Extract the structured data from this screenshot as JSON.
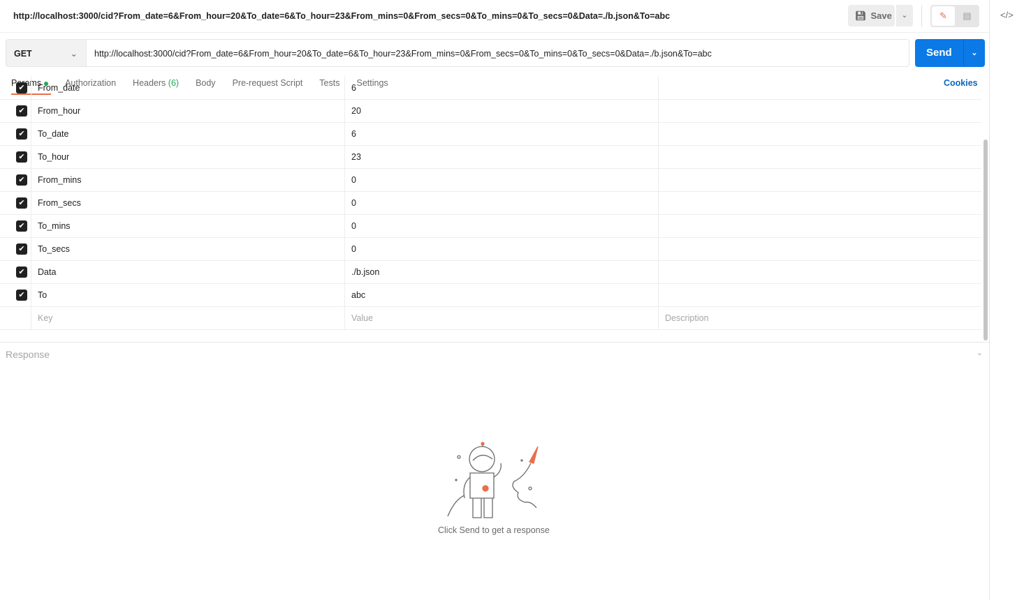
{
  "header": {
    "title": "http://localhost:3000/cid?From_date=6&From_hour=20&To_date=6&To_hour=23&From_mins=0&From_secs=0&To_mins=0&To_secs=0&Data=./b.json&To=abc",
    "save_label": "Save"
  },
  "request": {
    "method": "GET",
    "url": "http://localhost:3000/cid?From_date=6&From_hour=20&To_date=6&To_hour=23&From_mins=0&From_secs=0&To_mins=0&To_secs=0&Data=./b.json&To=abc",
    "send_label": "Send"
  },
  "tabs": [
    {
      "label": "Params"
    },
    {
      "label": "Authorization"
    },
    {
      "label": "Headers",
      "count": "(6)"
    },
    {
      "label": "Body"
    },
    {
      "label": "Pre-request Script"
    },
    {
      "label": "Tests"
    },
    {
      "label": "Settings"
    }
  ],
  "cookies_label": "Cookies",
  "params": [
    {
      "key": "From_date",
      "value": "6"
    },
    {
      "key": "From_hour",
      "value": "20"
    },
    {
      "key": "To_date",
      "value": "6"
    },
    {
      "key": "To_hour",
      "value": "23"
    },
    {
      "key": "From_mins",
      "value": "0"
    },
    {
      "key": "From_secs",
      "value": "0"
    },
    {
      "key": "To_mins",
      "value": "0"
    },
    {
      "key": "To_secs",
      "value": "0"
    },
    {
      "key": "Data",
      "value": "./b.json"
    },
    {
      "key": "To",
      "value": "abc"
    }
  ],
  "placeholders": {
    "key": "Key",
    "value": "Value",
    "description": "Description"
  },
  "response": {
    "title": "Response",
    "empty_text": "Click Send to get a response"
  },
  "colors": {
    "accent": "#e8704a",
    "send": "#0b79e6",
    "link": "#0a66c2",
    "active_dot": "#26a65b"
  }
}
